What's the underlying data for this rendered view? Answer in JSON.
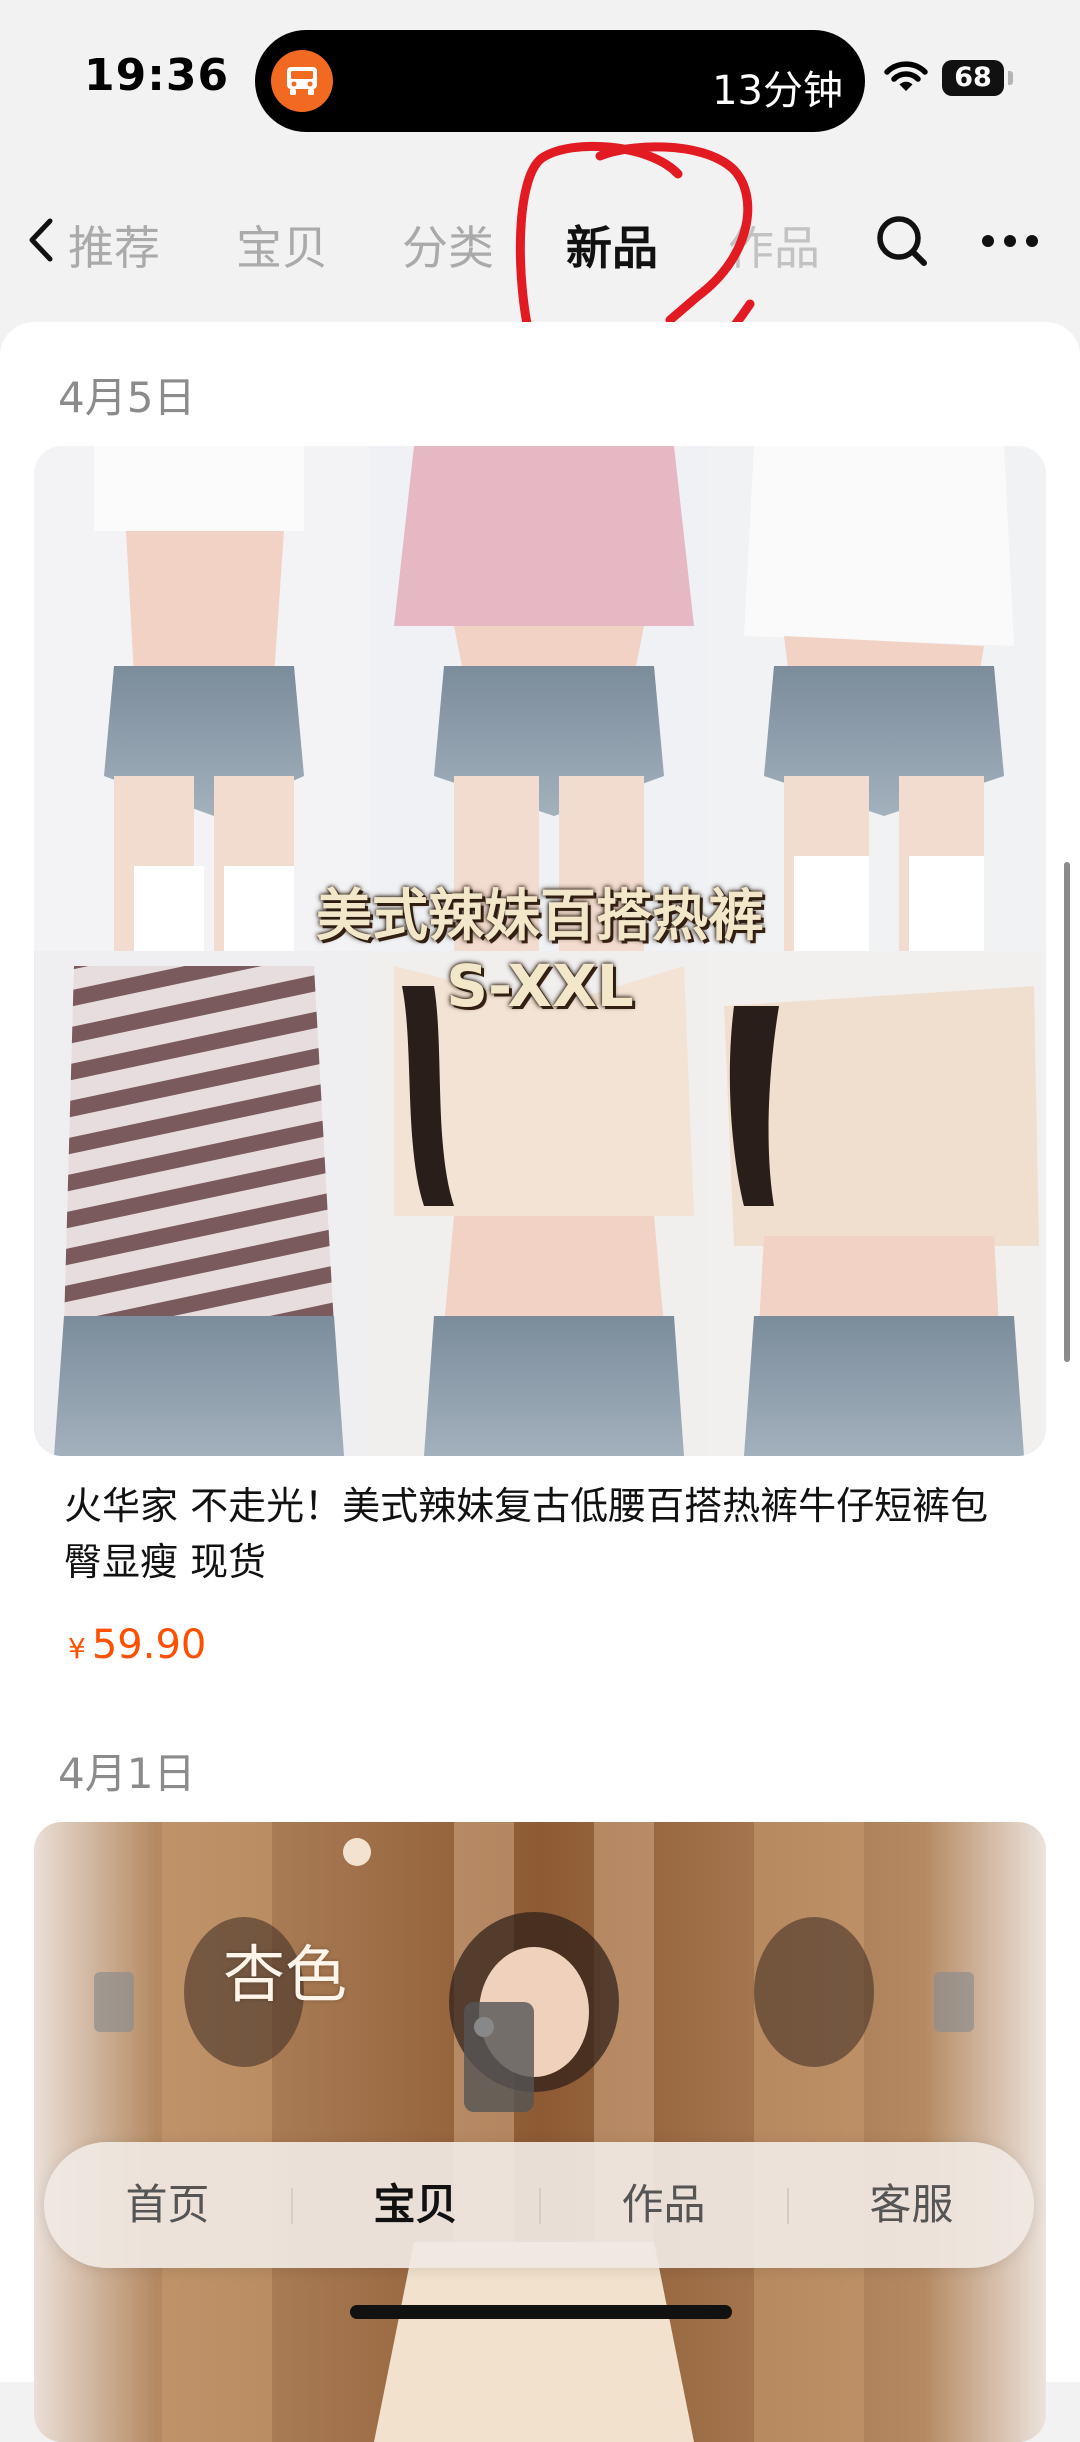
{
  "status_bar": {
    "time": "19:36",
    "live_activity_text": "13分钟",
    "battery": "68"
  },
  "nav": {
    "tabs": [
      {
        "label": "推荐"
      },
      {
        "label": "宝贝"
      },
      {
        "label": "分类"
      },
      {
        "label": "新品"
      },
      {
        "label": "作品"
      }
    ],
    "active_tab": "新品"
  },
  "feed": [
    {
      "date": "4月5日",
      "image_text": [
        "美式辣妹百搭热裤",
        "S-XXL"
      ],
      "title": "火华家 不走光！美式辣妹复古低腰百搭热裤牛仔短裤包臀显瘦 现货",
      "price_currency": "¥",
      "price": "59.90"
    },
    {
      "date": "4月1日",
      "image_text": [
        "杏色"
      ]
    }
  ],
  "bottom_tabs": [
    {
      "label": "首页"
    },
    {
      "label": "宝贝"
    },
    {
      "label": "作品"
    },
    {
      "label": "客服"
    }
  ],
  "active_bottom_tab": "宝贝",
  "colors": {
    "accent_price": "#ff5000",
    "annotation_red": "#e21b23",
    "live_activity_icon": "#f26a21"
  }
}
